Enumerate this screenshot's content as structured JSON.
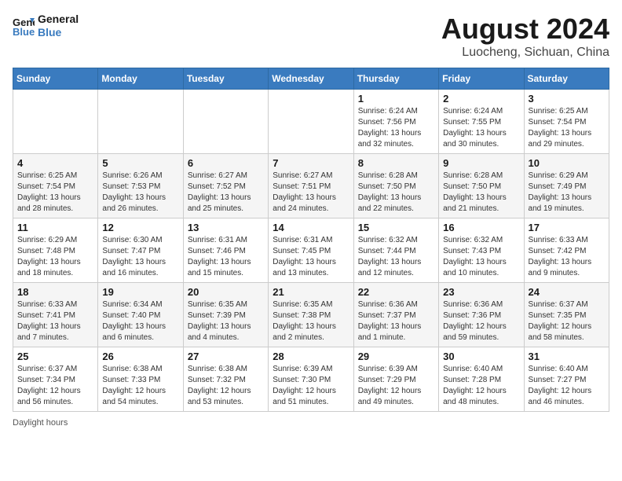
{
  "logo": {
    "line1": "General",
    "line2": "Blue"
  },
  "title": "August 2024",
  "subtitle": "Luocheng, Sichuan, China",
  "days_of_week": [
    "Sunday",
    "Monday",
    "Tuesday",
    "Wednesday",
    "Thursday",
    "Friday",
    "Saturday"
  ],
  "footer_note": "Daylight hours",
  "weeks": [
    [
      {
        "day": "",
        "sunrise": "",
        "sunset": "",
        "daylight": ""
      },
      {
        "day": "",
        "sunrise": "",
        "sunset": "",
        "daylight": ""
      },
      {
        "day": "",
        "sunrise": "",
        "sunset": "",
        "daylight": ""
      },
      {
        "day": "",
        "sunrise": "",
        "sunset": "",
        "daylight": ""
      },
      {
        "day": "1",
        "sunrise": "Sunrise: 6:24 AM",
        "sunset": "Sunset: 7:56 PM",
        "daylight": "Daylight: 13 hours and 32 minutes."
      },
      {
        "day": "2",
        "sunrise": "Sunrise: 6:24 AM",
        "sunset": "Sunset: 7:55 PM",
        "daylight": "Daylight: 13 hours and 30 minutes."
      },
      {
        "day": "3",
        "sunrise": "Sunrise: 6:25 AM",
        "sunset": "Sunset: 7:54 PM",
        "daylight": "Daylight: 13 hours and 29 minutes."
      }
    ],
    [
      {
        "day": "4",
        "sunrise": "Sunrise: 6:25 AM",
        "sunset": "Sunset: 7:54 PM",
        "daylight": "Daylight: 13 hours and 28 minutes."
      },
      {
        "day": "5",
        "sunrise": "Sunrise: 6:26 AM",
        "sunset": "Sunset: 7:53 PM",
        "daylight": "Daylight: 13 hours and 26 minutes."
      },
      {
        "day": "6",
        "sunrise": "Sunrise: 6:27 AM",
        "sunset": "Sunset: 7:52 PM",
        "daylight": "Daylight: 13 hours and 25 minutes."
      },
      {
        "day": "7",
        "sunrise": "Sunrise: 6:27 AM",
        "sunset": "Sunset: 7:51 PM",
        "daylight": "Daylight: 13 hours and 24 minutes."
      },
      {
        "day": "8",
        "sunrise": "Sunrise: 6:28 AM",
        "sunset": "Sunset: 7:50 PM",
        "daylight": "Daylight: 13 hours and 22 minutes."
      },
      {
        "day": "9",
        "sunrise": "Sunrise: 6:28 AM",
        "sunset": "Sunset: 7:50 PM",
        "daylight": "Daylight: 13 hours and 21 minutes."
      },
      {
        "day": "10",
        "sunrise": "Sunrise: 6:29 AM",
        "sunset": "Sunset: 7:49 PM",
        "daylight": "Daylight: 13 hours and 19 minutes."
      }
    ],
    [
      {
        "day": "11",
        "sunrise": "Sunrise: 6:29 AM",
        "sunset": "Sunset: 7:48 PM",
        "daylight": "Daylight: 13 hours and 18 minutes."
      },
      {
        "day": "12",
        "sunrise": "Sunrise: 6:30 AM",
        "sunset": "Sunset: 7:47 PM",
        "daylight": "Daylight: 13 hours and 16 minutes."
      },
      {
        "day": "13",
        "sunrise": "Sunrise: 6:31 AM",
        "sunset": "Sunset: 7:46 PM",
        "daylight": "Daylight: 13 hours and 15 minutes."
      },
      {
        "day": "14",
        "sunrise": "Sunrise: 6:31 AM",
        "sunset": "Sunset: 7:45 PM",
        "daylight": "Daylight: 13 hours and 13 minutes."
      },
      {
        "day": "15",
        "sunrise": "Sunrise: 6:32 AM",
        "sunset": "Sunset: 7:44 PM",
        "daylight": "Daylight: 13 hours and 12 minutes."
      },
      {
        "day": "16",
        "sunrise": "Sunrise: 6:32 AM",
        "sunset": "Sunset: 7:43 PM",
        "daylight": "Daylight: 13 hours and 10 minutes."
      },
      {
        "day": "17",
        "sunrise": "Sunrise: 6:33 AM",
        "sunset": "Sunset: 7:42 PM",
        "daylight": "Daylight: 13 hours and 9 minutes."
      }
    ],
    [
      {
        "day": "18",
        "sunrise": "Sunrise: 6:33 AM",
        "sunset": "Sunset: 7:41 PM",
        "daylight": "Daylight: 13 hours and 7 minutes."
      },
      {
        "day": "19",
        "sunrise": "Sunrise: 6:34 AM",
        "sunset": "Sunset: 7:40 PM",
        "daylight": "Daylight: 13 hours and 6 minutes."
      },
      {
        "day": "20",
        "sunrise": "Sunrise: 6:35 AM",
        "sunset": "Sunset: 7:39 PM",
        "daylight": "Daylight: 13 hours and 4 minutes."
      },
      {
        "day": "21",
        "sunrise": "Sunrise: 6:35 AM",
        "sunset": "Sunset: 7:38 PM",
        "daylight": "Daylight: 13 hours and 2 minutes."
      },
      {
        "day": "22",
        "sunrise": "Sunrise: 6:36 AM",
        "sunset": "Sunset: 7:37 PM",
        "daylight": "Daylight: 13 hours and 1 minute."
      },
      {
        "day": "23",
        "sunrise": "Sunrise: 6:36 AM",
        "sunset": "Sunset: 7:36 PM",
        "daylight": "Daylight: 12 hours and 59 minutes."
      },
      {
        "day": "24",
        "sunrise": "Sunrise: 6:37 AM",
        "sunset": "Sunset: 7:35 PM",
        "daylight": "Daylight: 12 hours and 58 minutes."
      }
    ],
    [
      {
        "day": "25",
        "sunrise": "Sunrise: 6:37 AM",
        "sunset": "Sunset: 7:34 PM",
        "daylight": "Daylight: 12 hours and 56 minutes."
      },
      {
        "day": "26",
        "sunrise": "Sunrise: 6:38 AM",
        "sunset": "Sunset: 7:33 PM",
        "daylight": "Daylight: 12 hours and 54 minutes."
      },
      {
        "day": "27",
        "sunrise": "Sunrise: 6:38 AM",
        "sunset": "Sunset: 7:32 PM",
        "daylight": "Daylight: 12 hours and 53 minutes."
      },
      {
        "day": "28",
        "sunrise": "Sunrise: 6:39 AM",
        "sunset": "Sunset: 7:30 PM",
        "daylight": "Daylight: 12 hours and 51 minutes."
      },
      {
        "day": "29",
        "sunrise": "Sunrise: 6:39 AM",
        "sunset": "Sunset: 7:29 PM",
        "daylight": "Daylight: 12 hours and 49 minutes."
      },
      {
        "day": "30",
        "sunrise": "Sunrise: 6:40 AM",
        "sunset": "Sunset: 7:28 PM",
        "daylight": "Daylight: 12 hours and 48 minutes."
      },
      {
        "day": "31",
        "sunrise": "Sunrise: 6:40 AM",
        "sunset": "Sunset: 7:27 PM",
        "daylight": "Daylight: 12 hours and 46 minutes."
      }
    ]
  ]
}
